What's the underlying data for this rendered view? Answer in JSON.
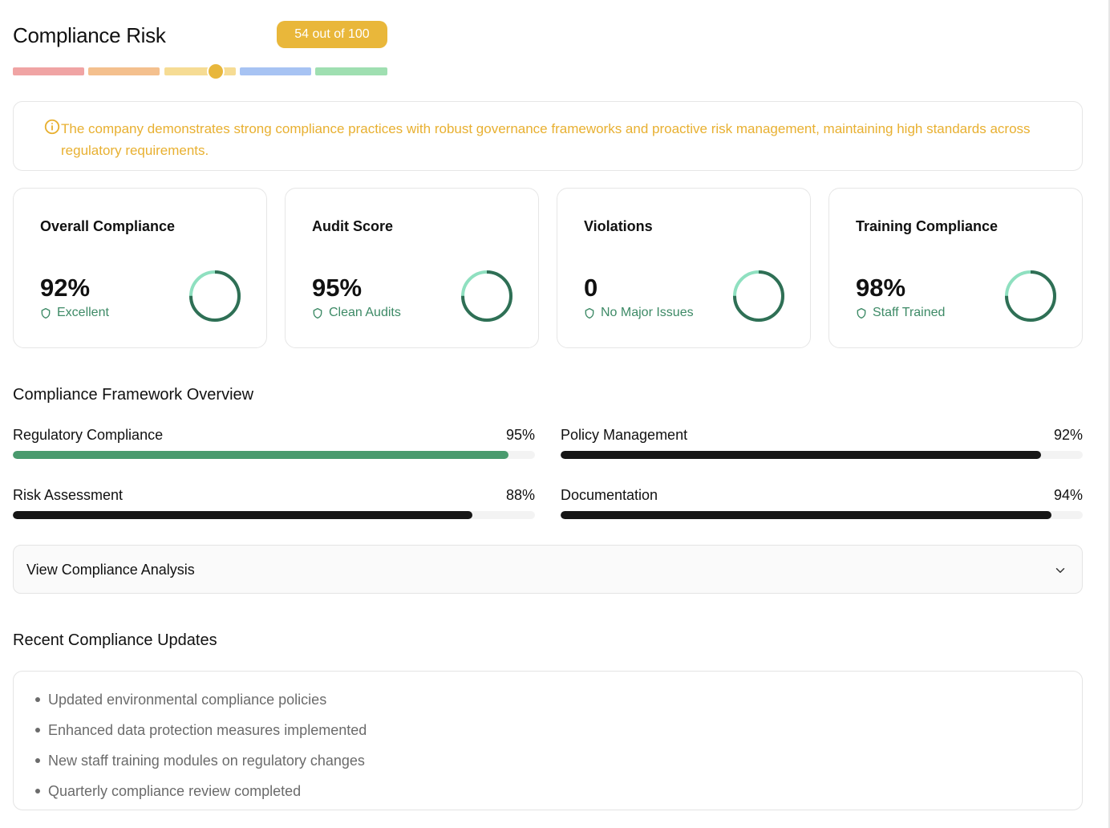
{
  "header": {
    "title": "Compliance Risk",
    "badge": "54 out of 100",
    "score": 54,
    "scale_colors": [
      "#f0a4a4",
      "#f4c08e",
      "#f6dc94",
      "#a7c3f3",
      "#9fdfb1"
    ],
    "knob_color": "#e8b73c"
  },
  "alert": {
    "text": "The company demonstrates strong compliance practices with robust governance frameworks and proactive risk management, maintaining high standards across regulatory requirements.",
    "icon": "info-circle-icon",
    "color": "#e8b031"
  },
  "cards": [
    {
      "title": "Overall Compliance",
      "value": "92%",
      "status": "Excellent",
      "icon": "shield-icon"
    },
    {
      "title": "Audit Score",
      "value": "95%",
      "status": "Clean Audits",
      "icon": "shield-icon"
    },
    {
      "title": "Violations",
      "value": "0",
      "status": "No Major Issues",
      "icon": "shield-icon"
    },
    {
      "title": "Training Compliance",
      "value": "98%",
      "status": "Staff Trained",
      "icon": "shield-icon"
    }
  ],
  "framework": {
    "title": "Compliance Framework Overview",
    "items": [
      {
        "label": "Regulatory Compliance",
        "value": "95%",
        "percent": 95,
        "color": "#4a9a6e"
      },
      {
        "label": "Policy Management",
        "value": "92%",
        "percent": 92,
        "color": "#161616"
      },
      {
        "label": "Risk Assessment",
        "value": "88%",
        "percent": 88,
        "color": "#161616"
      },
      {
        "label": "Documentation",
        "value": "94%",
        "percent": 94,
        "color": "#161616"
      }
    ]
  },
  "analysis": {
    "label": "View Compliance Analysis",
    "icon": "chevron-down-icon"
  },
  "updates": {
    "title": "Recent Compliance Updates",
    "items": [
      "Updated environmental compliance policies",
      "Enhanced data protection measures implemented",
      "New staff training modules on regulatory changes",
      "Quarterly compliance review completed"
    ]
  },
  "colors": {
    "ring_dark": "#2f6f55",
    "ring_light": "#8fe0c0",
    "status_green": "#3d8a66"
  }
}
